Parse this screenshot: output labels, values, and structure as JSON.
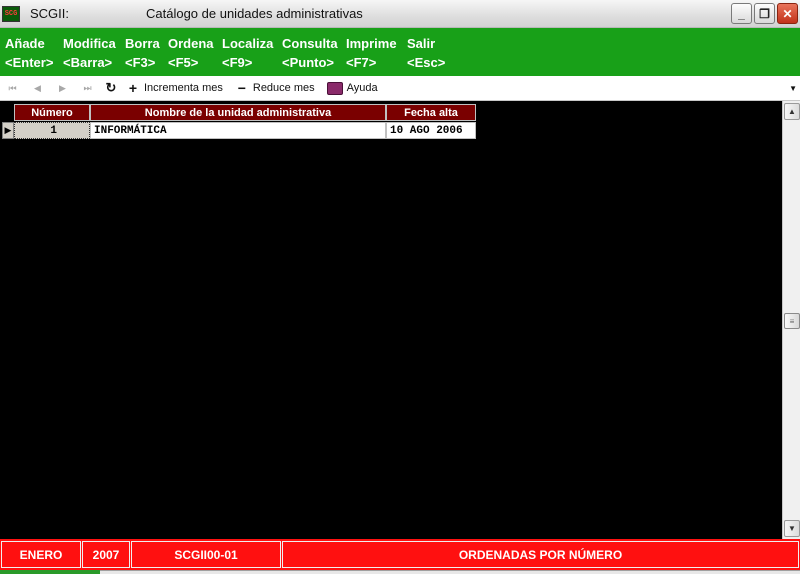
{
  "window": {
    "app_icon_text": "SCG",
    "app_name": "SCGII:",
    "title": "Catálogo de unidades administrativas",
    "minimize": "_",
    "restore": "❐",
    "close": "✕"
  },
  "menu": [
    {
      "label": "Añade",
      "key": "<Enter>"
    },
    {
      "label": "Modifica",
      "key": "<Barra>"
    },
    {
      "label": "Borra",
      "key": "<F3>"
    },
    {
      "label": "Ordena",
      "key": "<F5>"
    },
    {
      "label": "Localiza",
      "key": "<F9>"
    },
    {
      "label": "Consulta",
      "key": "<Punto>"
    },
    {
      "label": "Imprime",
      "key": "<F7>"
    },
    {
      "label": "Salir",
      "key": "<Esc>"
    }
  ],
  "toolbar": {
    "first": "⏮",
    "prev": "◀",
    "next": "▶",
    "last": "⏭",
    "refresh": "↻",
    "plus": "+",
    "increment_label": "Incrementa mes",
    "minus": "−",
    "reduce_label": "Reduce mes",
    "help_label": "Ayuda",
    "dropdown": "▼"
  },
  "grid": {
    "columns": [
      "Número",
      "Nombre de la unidad administrativa",
      "Fecha alta"
    ],
    "rows": [
      {
        "numero": "1",
        "nombre": "INFORMÁTICA",
        "fecha": "10 AGO 2006"
      }
    ],
    "row_marker": "▶"
  },
  "scrollbar": {
    "up": "▲",
    "down": "▼",
    "thumb": "≡"
  },
  "status": {
    "month": "ENERO",
    "year": "2007",
    "code": "SCGII00-01",
    "order": "ORDENADAS POR NÚMERO"
  }
}
